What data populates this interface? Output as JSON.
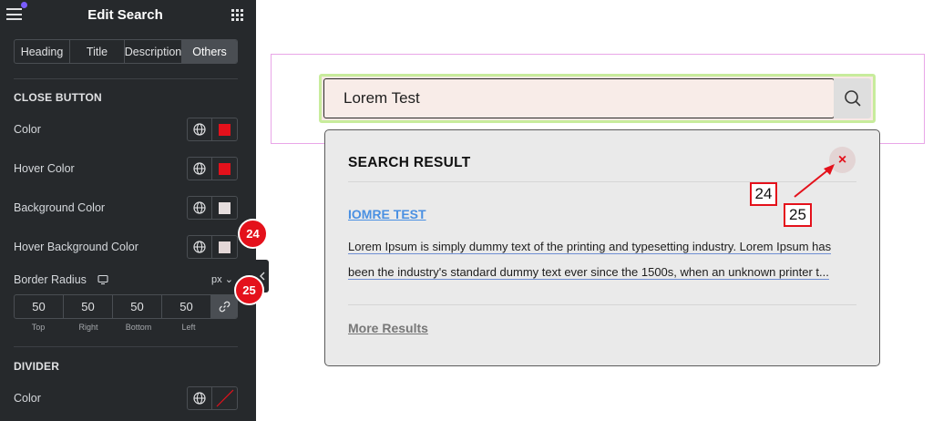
{
  "panel": {
    "title": "Edit Search",
    "tabs": [
      {
        "label": "Heading"
      },
      {
        "label": "Title"
      },
      {
        "label": "Description"
      },
      {
        "label": "Others",
        "active": true
      }
    ],
    "close_button": {
      "section_title": "CLOSE BUTTON",
      "controls": [
        {
          "label": "Color",
          "swatch": "#e4111b"
        },
        {
          "label": "Hover Color",
          "swatch": "#e4111b"
        },
        {
          "label": "Background Color",
          "swatch": "#e6dede"
        },
        {
          "label": "Hover Background Color",
          "swatch": "#e3d7d7"
        }
      ]
    },
    "border_radius": {
      "label": "Border Radius",
      "unit": "px",
      "values": [
        "50",
        "50",
        "50",
        "50"
      ],
      "sides": [
        "Top",
        "Right",
        "Bottom",
        "Left"
      ]
    },
    "divider": {
      "section_title": "DIVIDER",
      "color_label": "Color"
    }
  },
  "badges": [
    "24",
    "25"
  ],
  "preview": {
    "search_value": "Lorem Test",
    "results_title": "SEARCH RESULT",
    "close_glyph": "×",
    "result_link": "IOMRE TEST",
    "result_desc_line1": "Lorem Ipsum is simply dummy text of the printing and typesetting industry. Lorem Ipsum has",
    "result_desc_line2": "been the industry's standard dummy text ever since the 1500s, when an unknown printer t...",
    "more_results": "More Results"
  },
  "annotations": [
    "24",
    "25"
  ],
  "colors": {
    "panel_bg": "#26292c",
    "accent_red": "#e4111b",
    "link_blue": "#4a90e2",
    "selection_pink": "#e9a6e8",
    "focus_green": "#c8ec9c"
  }
}
